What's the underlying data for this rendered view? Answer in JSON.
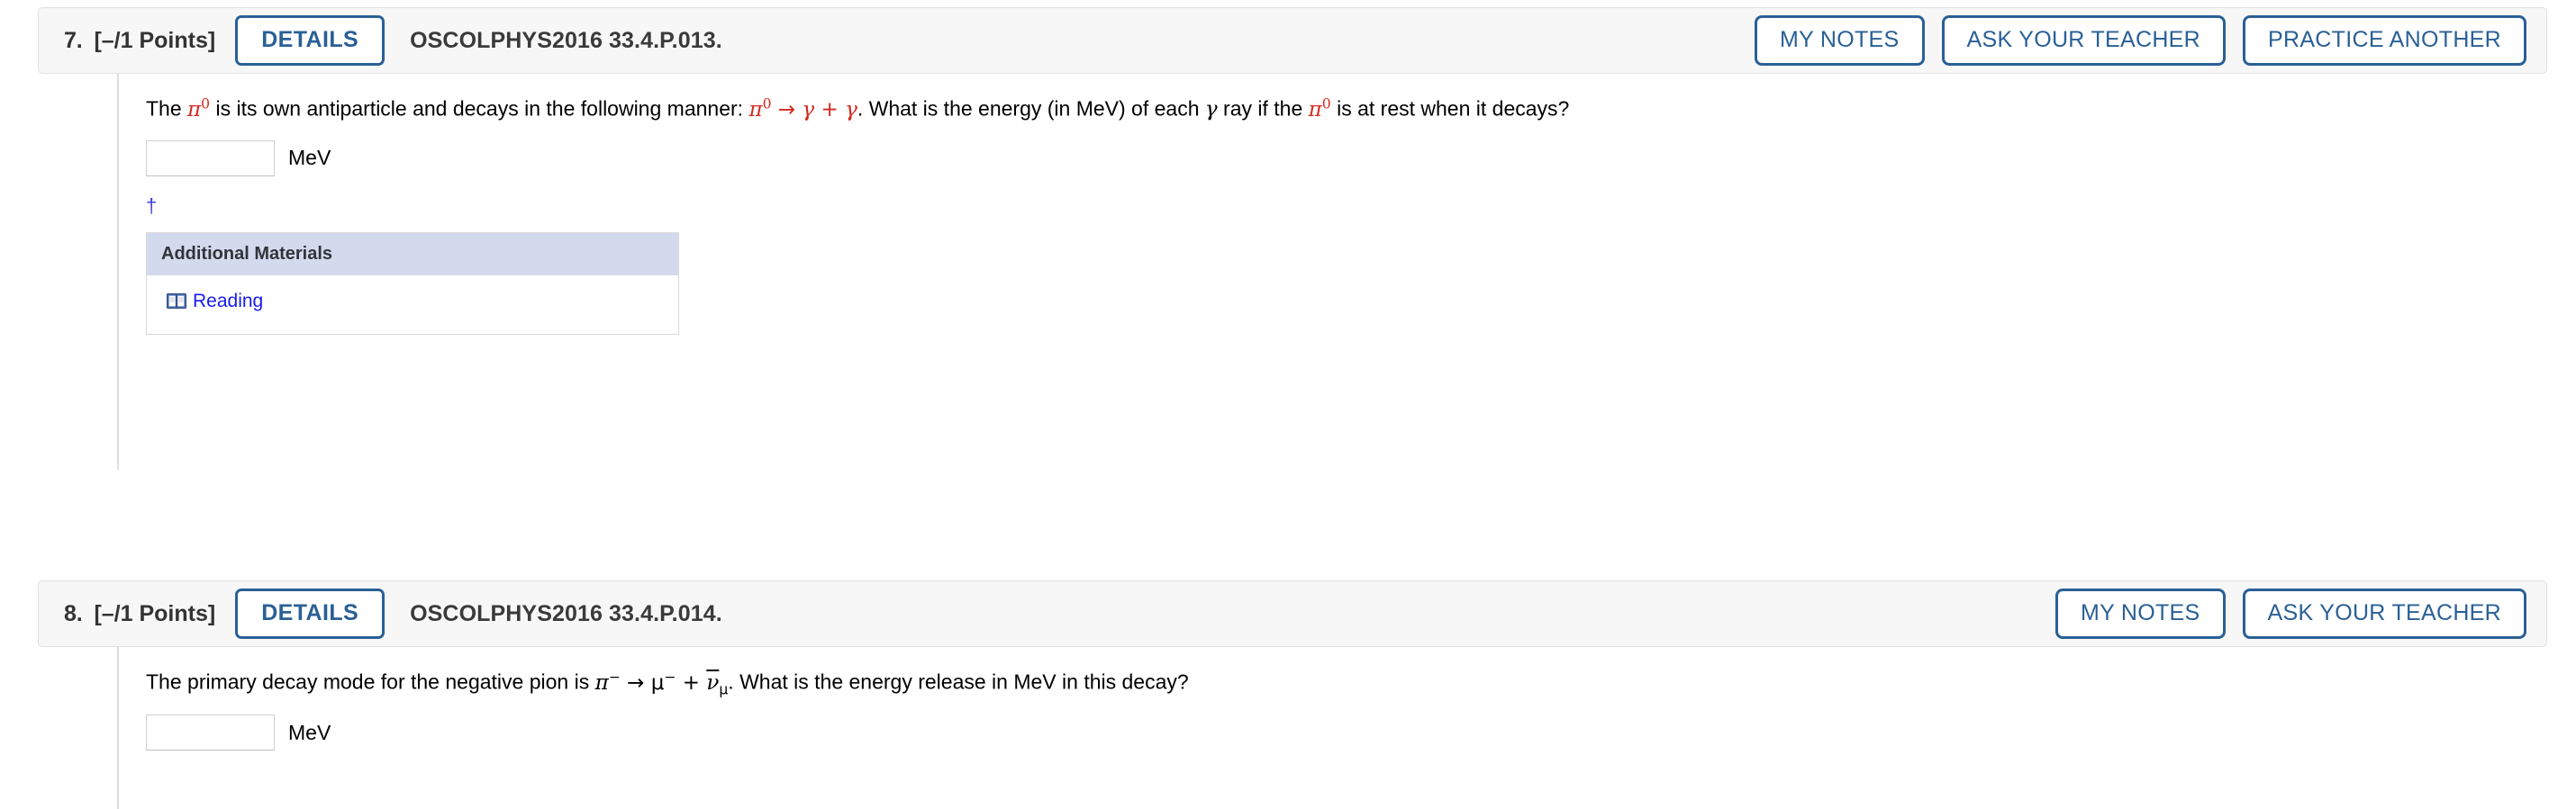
{
  "questions": [
    {
      "number": "7.",
      "points": "[–/1 Points]",
      "details_label": "DETAILS",
      "question_id": "OSCOLPHYS2016 33.4.P.013.",
      "actions": [
        "MY NOTES",
        "ASK YOUR TEACHER",
        "PRACTICE ANOTHER"
      ],
      "prompt": {
        "part1": "The ",
        "pi_symbol": "π",
        "pi_superscript": "0",
        "part2": " is its own antiparticle and decays in the following manner: ",
        "eq_pi": "π",
        "eq_pi_sup": "0",
        "eq_arrow": " → ",
        "eq_gamma1": "γ",
        "eq_plus": " + ",
        "eq_gamma2": "γ",
        "part3": ". What is the energy (in MeV) of each ",
        "gamma_inline": "γ",
        "part4": " ray if the ",
        "pi_symbol2": "π",
        "pi_superscript2": "0",
        "part5": " is at rest when it decays?"
      },
      "answer_value": "",
      "answer_placeholder": "",
      "unit": "MeV",
      "footnote_marker": "†",
      "materials": {
        "header": "Additional Materials",
        "items": [
          {
            "label": "Reading",
            "icon": "book-icon"
          }
        ]
      }
    },
    {
      "number": "8.",
      "points": "[–/1 Points]",
      "details_label": "DETAILS",
      "question_id": "OSCOLPHYS2016 33.4.P.014.",
      "actions": [
        "MY NOTES",
        "ASK YOUR TEACHER"
      ],
      "prompt": {
        "part1": "The primary decay mode for the negative pion is ",
        "eq_pi": "π",
        "eq_pi_sup": "−",
        "eq_arrow": " → ",
        "eq_mu": "μ",
        "eq_mu_sup": "−",
        "eq_plus": " + ",
        "eq_nu": "ν",
        "eq_nu_sub": "μ",
        "part2": ". What is the energy release in MeV in this decay?"
      },
      "answer_value": "",
      "answer_placeholder": "",
      "unit": "MeV"
    }
  ],
  "colors": {
    "accent_blue": "#2a6096",
    "link_blue": "#1a1aee",
    "symbol_red": "#d4291f",
    "materials_header": "#d4daee",
    "header_bg": "#f7f7f7"
  }
}
